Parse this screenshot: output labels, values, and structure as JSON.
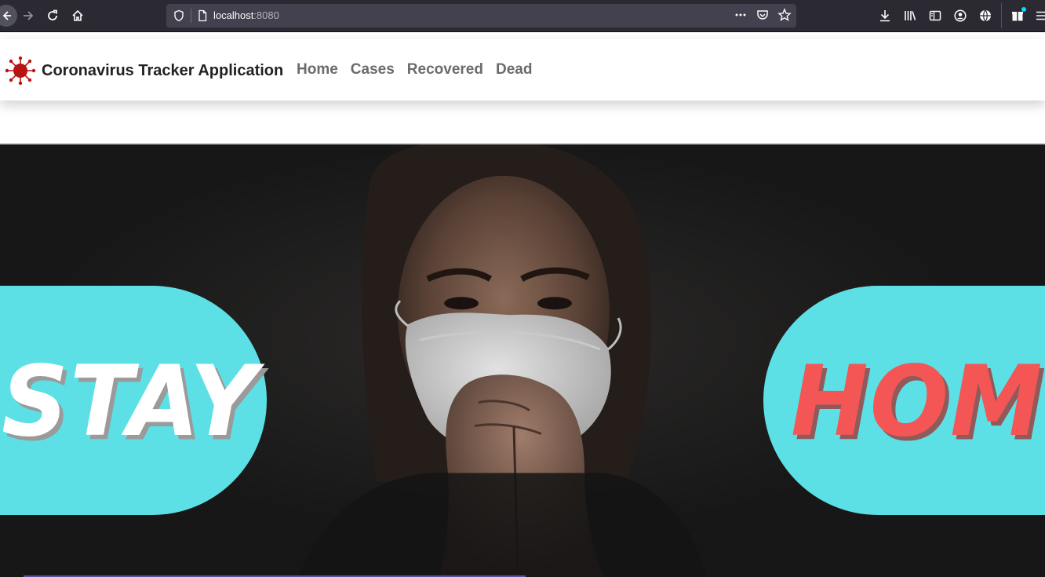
{
  "browser": {
    "url_host": "localhost",
    "url_port": ":8080"
  },
  "navbar": {
    "brand": "Coronavirus Tracker Application",
    "links": [
      {
        "label": "Home"
      },
      {
        "label": "Cases"
      },
      {
        "label": "Recovered"
      },
      {
        "label": "Dead"
      }
    ]
  },
  "hero": {
    "left_word": "STAY",
    "right_word": "HOME"
  },
  "colors": {
    "pill": "#5ce0e6",
    "home_word": "#f45655",
    "virus_red": "#b81414"
  }
}
